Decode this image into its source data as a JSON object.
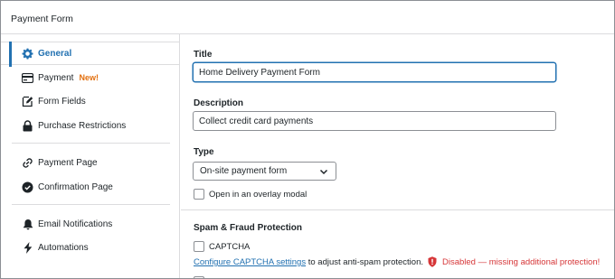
{
  "window": {
    "title": "Payment Form"
  },
  "sidebar": {
    "items": [
      {
        "label": "General",
        "icon": "gear-icon"
      },
      {
        "label": "Payment",
        "badge": "New!",
        "icon": "credit-card-icon"
      },
      {
        "label": "Form Fields",
        "icon": "edit-icon"
      },
      {
        "label": "Purchase Restrictions",
        "icon": "lock-icon"
      },
      {
        "label": "Payment Page",
        "icon": "link-icon"
      },
      {
        "label": "Confirmation Page",
        "icon": "check-circle-icon"
      },
      {
        "label": "Email Notifications",
        "icon": "bell-icon"
      },
      {
        "label": "Automations",
        "icon": "lightning-icon"
      }
    ]
  },
  "main": {
    "title_label": "Title",
    "title_value": "Home Delivery Payment Form",
    "description_label": "Description",
    "description_value": "Collect credit card payments",
    "type_label": "Type",
    "type_value": "On-site payment form",
    "overlay_label": "Open in an overlay modal",
    "spam_heading": "Spam & Fraud Protection",
    "captcha_label": "CAPTCHA",
    "captcha_link": "Configure CAPTCHA settings",
    "captcha_note": "to adjust anti-spam protection.",
    "warning": "Disabled — missing additional protection!"
  },
  "colors": {
    "accent": "#2271b1",
    "danger": "#d63638",
    "new_badge": "#e26f0e"
  }
}
